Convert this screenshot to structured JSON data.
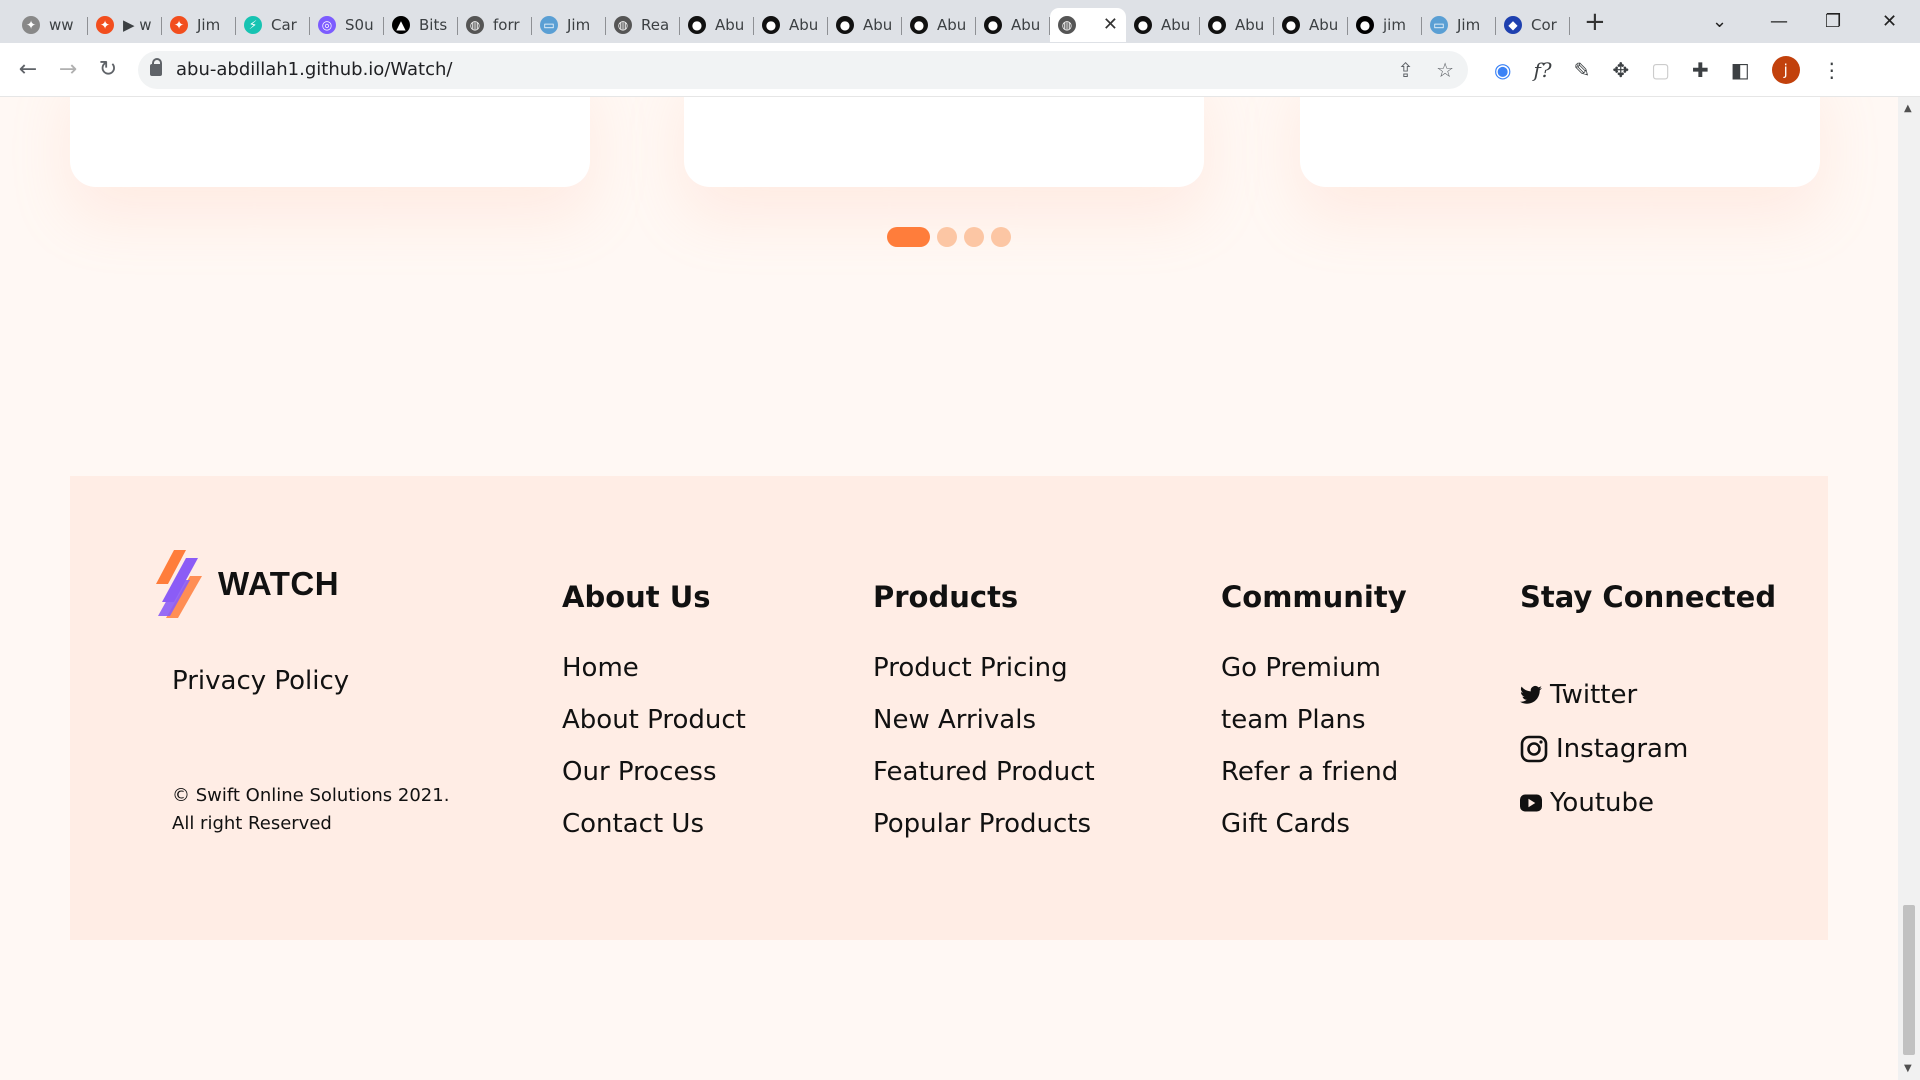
{
  "browser": {
    "tabs": [
      {
        "title": "ww",
        "fav": "figma-icon",
        "color": "#888"
      },
      {
        "title": "▶ w",
        "fav": "figma-icon",
        "color": "#f24e1e"
      },
      {
        "title": "Jim",
        "fav": "figma-icon",
        "color": "#f24e1e"
      },
      {
        "title": "Car",
        "fav": "bolt-icon",
        "color": "#17c3b2"
      },
      {
        "title": "S0u",
        "fav": "swirl-icon",
        "color": "#7c5cff"
      },
      {
        "title": "Bits",
        "fav": "triangle-icon",
        "color": "#000"
      },
      {
        "title": "forr",
        "fav": "globe-icon",
        "color": "#555"
      },
      {
        "title": "Jim",
        "fav": "doc-icon",
        "color": "#5a9fd4"
      },
      {
        "title": "Rea",
        "fav": "globe-icon",
        "color": "#555"
      },
      {
        "title": "Abu",
        "fav": "github-icon",
        "color": "#111"
      },
      {
        "title": "Abu",
        "fav": "github-icon",
        "color": "#111"
      },
      {
        "title": "Abu",
        "fav": "github-icon",
        "color": "#111"
      },
      {
        "title": "Abu",
        "fav": "github-icon",
        "color": "#111"
      },
      {
        "title": "Abu",
        "fav": "github-icon",
        "color": "#111"
      },
      {
        "title": "",
        "fav": "globe-icon",
        "color": "#555",
        "active": true
      },
      {
        "title": "Abu",
        "fav": "github-icon",
        "color": "#111"
      },
      {
        "title": "Abu",
        "fav": "github-icon",
        "color": "#111"
      },
      {
        "title": "Abu",
        "fav": "github-icon",
        "color": "#111"
      },
      {
        "title": "jim",
        "fav": "circle-icon",
        "color": "#000"
      },
      {
        "title": "Jim",
        "fav": "doc-icon",
        "color": "#5a9fd4"
      },
      {
        "title": "Cor",
        "fav": "shield-icon",
        "color": "#1e40af"
      }
    ],
    "url": "abu-abdillah1.github.io/Watch/",
    "profile_initial": "j"
  },
  "carousel": {
    "slides": 4,
    "active_index": 0
  },
  "footer": {
    "brand": "WATCH",
    "privacy": "Privacy Policy",
    "copyright_line1": "© Swift Online Solutions 2021.",
    "copyright_line2": "All right Reserved",
    "columns": [
      {
        "heading": "About Us",
        "links": [
          "Home",
          "About Product",
          "Our Process",
          "Contact Us"
        ]
      },
      {
        "heading": "Products",
        "links": [
          "Product Pricing",
          "New Arrivals",
          "Featured Product",
          "Popular Products"
        ]
      },
      {
        "heading": "Community",
        "links": [
          "Go Premium",
          "team Plans",
          "Refer a friend",
          "Gift Cards"
        ]
      }
    ],
    "social": {
      "heading": "Stay Connected",
      "links": [
        {
          "label": "Twitter",
          "icon": "twitter-icon"
        },
        {
          "label": "Instagram",
          "icon": "instagram-icon"
        },
        {
          "label": "Youtube",
          "icon": "youtube-icon"
        }
      ]
    }
  },
  "colors": {
    "accent": "#ff7d3b",
    "dot": "#fcc6a4",
    "footer_bg": "#ffede5",
    "page_bg": "#fff8f4"
  }
}
